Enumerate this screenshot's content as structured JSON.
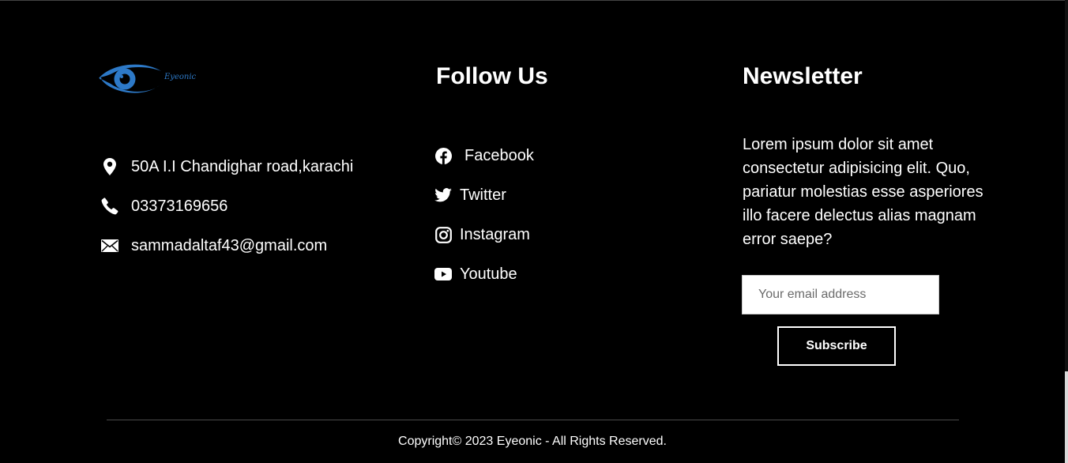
{
  "brand": {
    "name": "Eyeonic",
    "logo_color": "#2d79c7"
  },
  "contact": {
    "items": [
      {
        "icon": "map-pin-icon",
        "text": "50A I.I Chandighar road,karachi"
      },
      {
        "icon": "phone-icon",
        "text": "03373169656"
      },
      {
        "icon": "envelope-icon",
        "text": "sammadaltaf43@gmail.com"
      }
    ]
  },
  "follow": {
    "title": "Follow Us",
    "items": [
      {
        "icon": "facebook-icon",
        "label": "Facebook"
      },
      {
        "icon": "twitter-icon",
        "label": "Twitter"
      },
      {
        "icon": "instagram-icon",
        "label": "Instagram"
      },
      {
        "icon": "youtube-icon",
        "label": "Youtube"
      }
    ]
  },
  "newsletter": {
    "title": "Newsletter",
    "text": "Lorem ipsum dolor sit amet consectetur adipisicing elit. Quo, pariatur molestias esse asperiores illo facere delectus alias magnam error saepe?",
    "email_placeholder": "Your email address",
    "email_value": "",
    "subscribe_label": "Subscribe"
  },
  "footer": {
    "copyright": "Copyright© 2023 Eyeonic - All Rights Reserved."
  },
  "colors": {
    "background": "#000000",
    "text": "#ffffff",
    "accent": "#2d79c7"
  }
}
